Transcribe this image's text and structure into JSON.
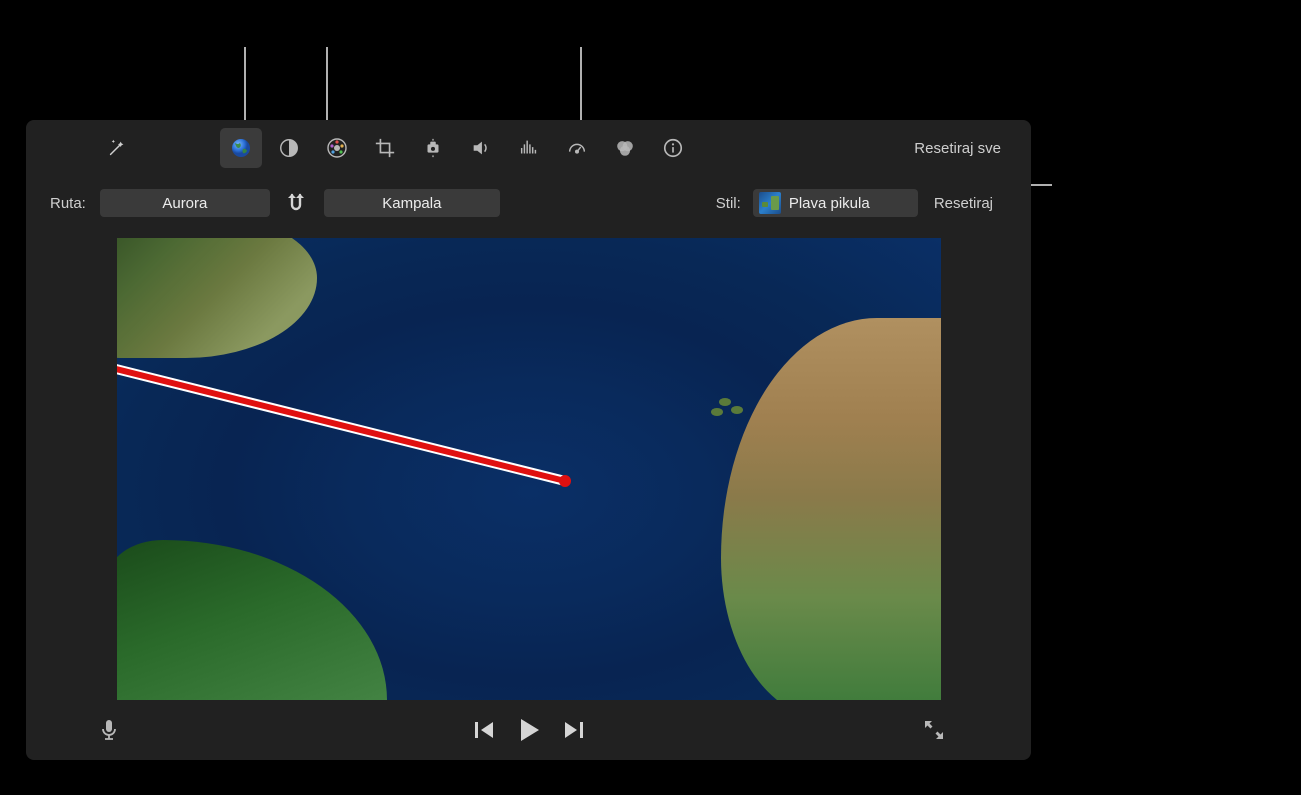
{
  "toolbar": {
    "reset_all_label": "Resetiraj sve"
  },
  "route": {
    "label": "Ruta:",
    "from": "Aurora",
    "to": "Kampala"
  },
  "style": {
    "label": "Stil:",
    "selected": "Plava pikula",
    "reset_label": "Resetiraj"
  }
}
